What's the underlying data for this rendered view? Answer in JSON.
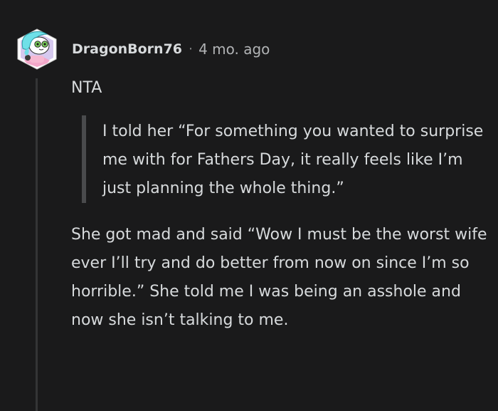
{
  "comment": {
    "author": "DragonBorn76",
    "separator": "·",
    "timestamp": "4 mo. ago",
    "body_intro": "NTA",
    "quote_text": "I told her “For something you wanted to surprise me with for Fathers Day, it really feels like I’m just planning the whole thing.”",
    "body_text": "She got mad and said “Wow I must be the worst wife ever I’ll try and do better from now on since I’m so horrible.” She told me I was being an asshole and now she isn’t talking to me."
  },
  "avatar": {
    "icon": "snoo-avatar-icon",
    "hair_color": "#6fe0e8",
    "face_color": "#ffffff",
    "eye_color": "#7bd15a",
    "shirt_color": "#f3a7c9"
  },
  "colors": {
    "background": "#1a1a1b",
    "text": "#d7dadc",
    "meta": "#818384",
    "thread_line": "#343536",
    "quote_bar": "#4a4b4d"
  }
}
